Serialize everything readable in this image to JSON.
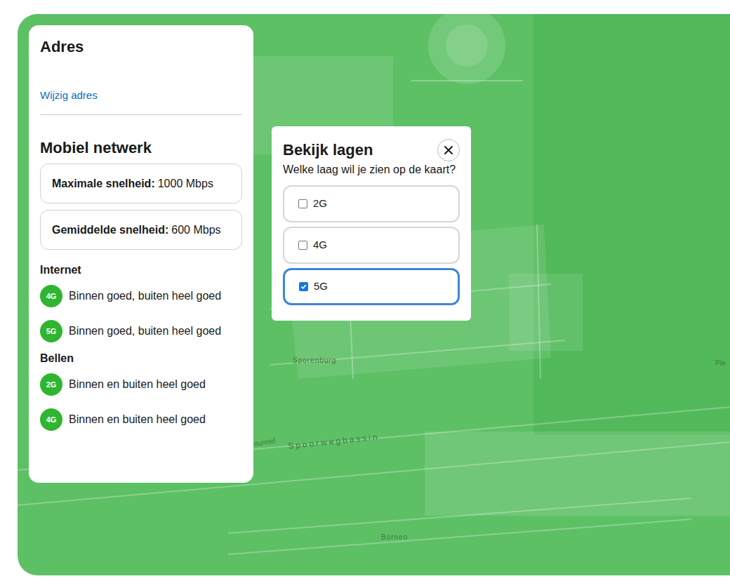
{
  "address": {
    "title": "Adres",
    "change_link": "Wijzig adres"
  },
  "network": {
    "title": "Mobiel netwerk",
    "speeds": [
      {
        "label": "Maximale snelheid:",
        "value": "1000 Mbps"
      },
      {
        "label": "Gemiddelde snelheid:",
        "value": "600 Mbps"
      }
    ],
    "sections": [
      {
        "title": "Internet",
        "items": [
          {
            "badge": "4G",
            "text": "Binnen goed, buiten heel goed"
          },
          {
            "badge": "5G",
            "text": "Binnen goed, buiten heel goed"
          }
        ]
      },
      {
        "title": "Bellen",
        "items": [
          {
            "badge": "2G",
            "text": "Binnen en buiten heel goed"
          },
          {
            "badge": "4G",
            "text": "Binnen en buiten heel goed"
          }
        ]
      }
    ]
  },
  "layers_dialog": {
    "title": "Bekijk lagen",
    "question": "Welke laag wil je zien op de kaart?",
    "options": [
      {
        "label": "2G",
        "checked": false,
        "selected": false
      },
      {
        "label": "4G",
        "checked": false,
        "selected": false
      },
      {
        "label": "5G",
        "checked": true,
        "selected": true
      }
    ]
  },
  "map": {
    "labels": [
      {
        "text": "Sporenburg"
      },
      {
        "text": "Spoorwegbassin"
      },
      {
        "text": "Borneo"
      },
      {
        "text": "intunnel"
      },
      {
        "text": "Pie"
      }
    ]
  }
}
